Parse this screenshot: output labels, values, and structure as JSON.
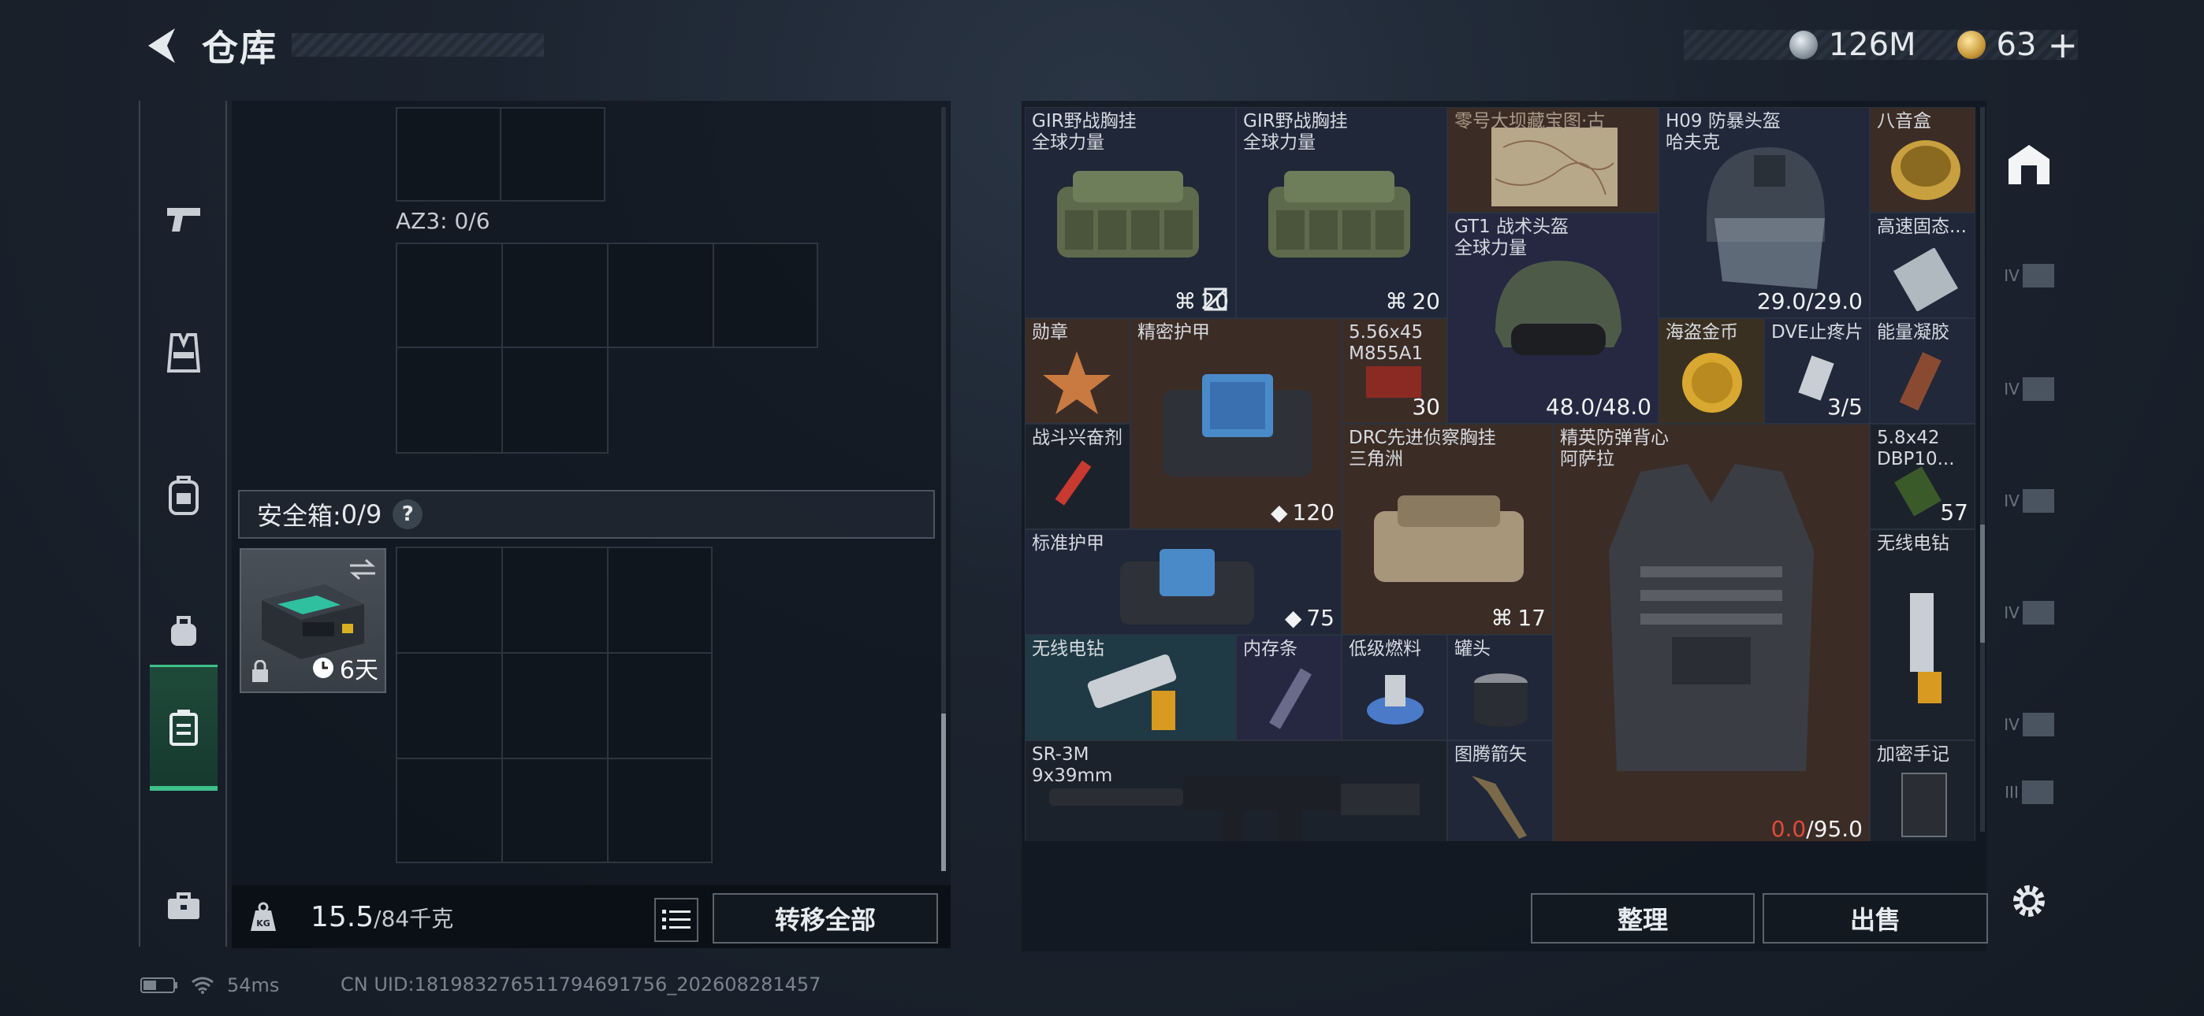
{
  "header": {
    "title": "仓库"
  },
  "currency": {
    "silver_amount": "126M",
    "gold_amount": "63",
    "gold_add": "+"
  },
  "left_nav": {
    "items": [
      "weapons",
      "chest-rig",
      "backpack",
      "pouch",
      "safe-box",
      "briefcase"
    ],
    "active": "safe-box"
  },
  "left_panel": {
    "az3_label": "AZ3: 0/6",
    "safe_box_label": "安全箱:",
    "safe_box_count": "0/9",
    "help": "?",
    "safe_box_timer": "6天",
    "weight_current": "15.5",
    "weight_max": "/84千克",
    "transfer_all": "转移全部"
  },
  "inventory": {
    "items": [
      {
        "id": "gir1",
        "label": "GIR野战胸挂\n全球力量",
        "value": "20",
        "badge": "rig"
      },
      {
        "id": "gir2",
        "label": "GIR野战胸挂\n全球力量",
        "value": "20",
        "badge": "rig"
      },
      {
        "id": "map",
        "label": "零号大坝藏宝图·古",
        "value": ""
      },
      {
        "id": "h09",
        "label": "H09 防暴头盔\n哈夫克",
        "value": "29.0/29.0"
      },
      {
        "id": "music",
        "label": "八音盒",
        "value": ""
      },
      {
        "id": "gt1",
        "label": "GT1 战术头盔\n全球力量",
        "value": "48.0/48.0"
      },
      {
        "id": "ssd",
        "label": "高速固态...",
        "value": ""
      },
      {
        "id": "medal",
        "label": "勋章",
        "value": ""
      },
      {
        "id": "precision",
        "label": "精密护甲",
        "value": "120",
        "badge": "shield"
      },
      {
        "id": "ammo556",
        "label": "5.56x45\nM855A1",
        "value": "30"
      },
      {
        "id": "coin",
        "label": "海盗金币",
        "value": ""
      },
      {
        "id": "dve",
        "label": "DVE止疼片",
        "value": "3/5"
      },
      {
        "id": "gel",
        "label": "能量凝胶",
        "value": ""
      },
      {
        "id": "stim",
        "label": "战斗兴奋剂",
        "value": ""
      },
      {
        "id": "drc",
        "label": "DRC先进侦察胸挂\n三角洲",
        "value": "17",
        "badge": "rig"
      },
      {
        "id": "elite",
        "label": "精英防弹背心\n阿萨拉",
        "value_red": "0.0",
        "value": "/95.0"
      },
      {
        "id": "ammo58",
        "label": "5.8x42\nDBP10...",
        "value": "57"
      },
      {
        "id": "std_armor",
        "label": "标准护甲",
        "value": "75",
        "badge": "shield"
      },
      {
        "id": "drill2",
        "label": "无线电钻",
        "value": ""
      },
      {
        "id": "drill",
        "label": "无线电钻",
        "value": ""
      },
      {
        "id": "ram",
        "label": "内存条",
        "value": ""
      },
      {
        "id": "fuel",
        "label": "低级燃料",
        "value": ""
      },
      {
        "id": "can",
        "label": "罐头",
        "value": ""
      },
      {
        "id": "sr3m",
        "label": "SR-3M\n9x39mm",
        "value": ""
      },
      {
        "id": "arrow",
        "label": "图腾箭矢",
        "value": ""
      },
      {
        "id": "notebook",
        "label": "加密手记",
        "value": ""
      }
    ]
  },
  "buttons": {
    "organize": "整理",
    "sell": "出售"
  },
  "right_nav": {
    "tiers": [
      "IV",
      "IV",
      "IV",
      "IV",
      "IV",
      "III"
    ]
  },
  "status": {
    "ping": "54ms",
    "uid": "CN UID:1819832765117946917​56_202608281457"
  }
}
